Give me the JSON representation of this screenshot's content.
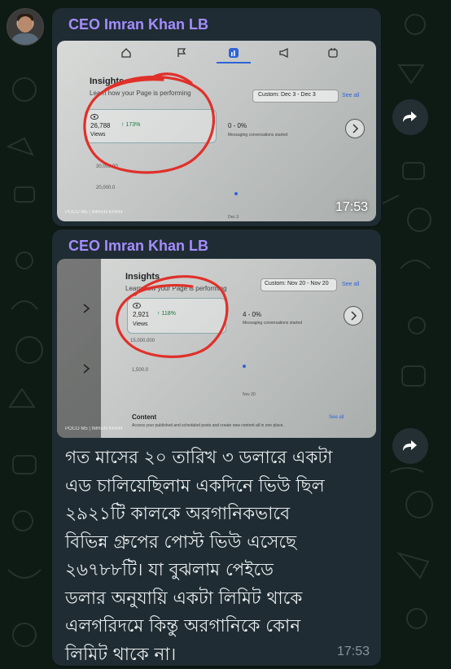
{
  "colors": {
    "wallpaper": "#0e1a14",
    "bubble": "#1f2c33",
    "sender_name": "#a48dff",
    "message_text": "#e9edef",
    "timestamp": "#8696a0",
    "annotation_circle": "#e0302a"
  },
  "avatar": {
    "icon": "user-avatar"
  },
  "messages": [
    {
      "sender": "CEO Imran Khan LB",
      "type": "photo",
      "time": "17:53",
      "forward_icon": "forward-icon",
      "photo": {
        "title": "Insights",
        "subtitle": "Learn how your Page is performing",
        "date_range": "Custom: Dec 3 - Dec 3",
        "see_all": "See all",
        "views_value": "26,788",
        "views_change": "↑ 173%",
        "views_label": "Views",
        "messaging_value": "0 - 0%",
        "messaging_label": "Messaging conversations started",
        "axis_1": "30,000.00",
        "axis_2": "20,000.0",
        "xtick": "Dec 3",
        "watermark": "POCO M5 | IMRAN KHAN"
      }
    },
    {
      "sender": "CEO Imran Khan LB",
      "type": "photo+text",
      "time": "17:53",
      "forward_icon": "forward-icon",
      "photo": {
        "title": "Insights",
        "subtitle": "Learn how your Page is performing",
        "date_range": "Custom: Nov 20 - Nov 20",
        "see_all": "See all",
        "views_value": "2,921",
        "views_change": "↑ 118%",
        "views_label": "Views",
        "messaging_value": "4 - 0%",
        "messaging_label": "Messaging conversations started",
        "axis_1": "15,000.000",
        "axis_2": "1,500.0",
        "xtick": "Nov 20",
        "content_title": "Content",
        "content_sub": "Access your published and scheduled posts and create new content all in one place.",
        "see_all_2": "See all",
        "watermark": "POCO M5 | IMRAN KHAN"
      },
      "text": "গত মাসের ২০ তারিখ ৩ ডলারে একটা\nএড চালিয়েছিলাম একদিনে ভিউ ছিল\n২৯২১টি কালকে অরগানিকভাবে\nবিভিন্ন গ্রুপের পোস্ট ভিউ এসেছে\n২৬৭৮৮টি। যা বুঝলাম পেইডে\nডলার অনুযায়ি একটা লিমিট থাকে\nএলগরিদমে কিন্তু অরগানিকে কোন\nলিমিট থাকে না।"
    }
  ]
}
